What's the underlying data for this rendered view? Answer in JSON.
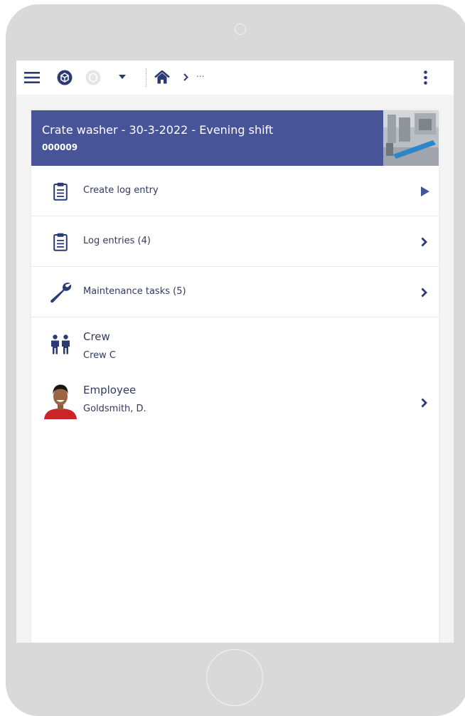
{
  "colors": {
    "primary": "#485498",
    "icon": "#2b3a75",
    "text": "#323a62",
    "device": "#d9d9d9",
    "screen_bg": "#f4f4f4"
  },
  "topbar": {
    "menu_icon": "hamburger-icon",
    "app_icon": "cube-badge-icon",
    "disabled_icon": "cube-badge-icon",
    "dropdown_icon": "caret-down-icon",
    "home_icon": "home-icon",
    "breadcrumb_separator": "›",
    "breadcrumb_text": "...",
    "more_icon": "kebab-vertical-icon"
  },
  "header": {
    "title": "Crate washer - 30-3-2022 - Evening shift",
    "code": "000009",
    "thumbnail_icon": "machine-photo"
  },
  "actions": [
    {
      "label": "Create log entry",
      "icon": "clipboard-icon",
      "chevron": "triangle-right-icon"
    },
    {
      "label": "Log entries (4)",
      "icon": "clipboard-icon",
      "chevron": "chevron-right-icon"
    },
    {
      "label": "Maintenance tasks (5)",
      "icon": "wrench-icon",
      "chevron": "chevron-right-icon"
    }
  ],
  "properties": [
    {
      "title": "Crew",
      "value": "Crew C",
      "icon": "people-icon"
    },
    {
      "title": "Employee",
      "value": "Goldsmith, D.",
      "icon": "avatar",
      "chevron": "chevron-right-icon"
    }
  ]
}
